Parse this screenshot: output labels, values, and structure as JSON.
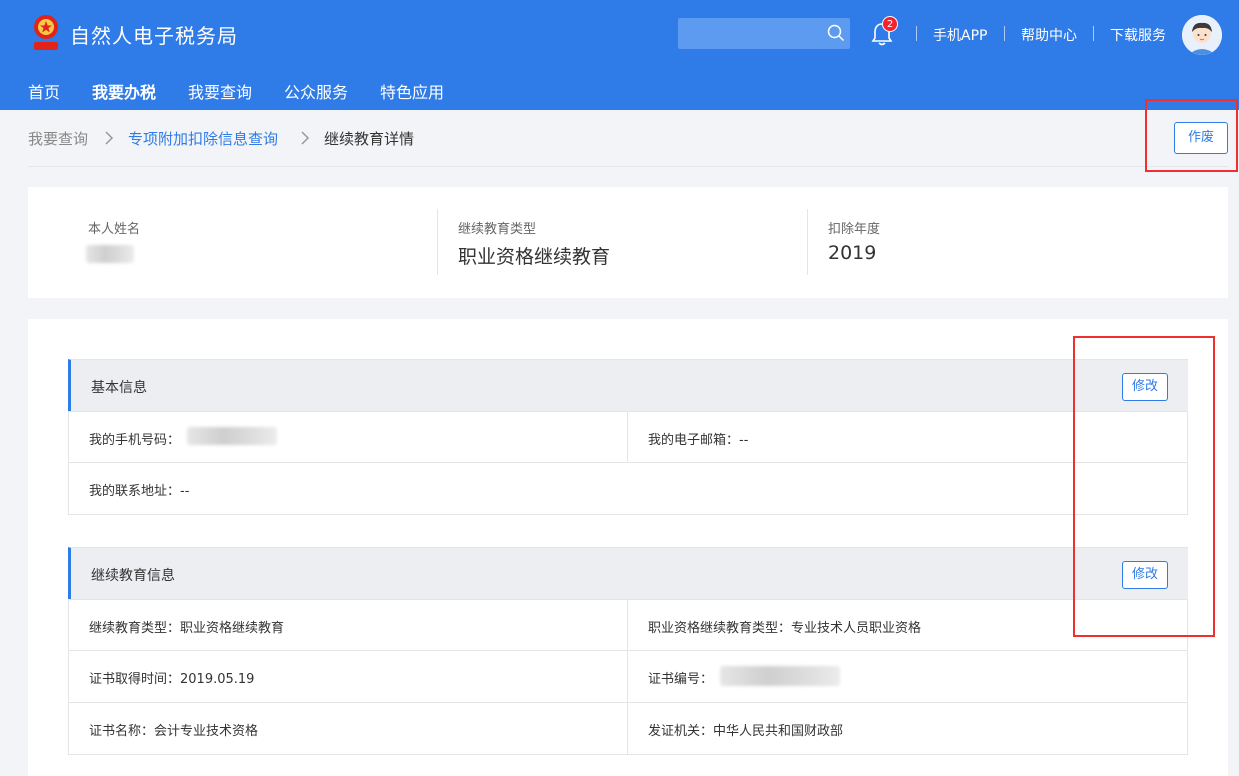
{
  "header": {
    "title": "自然人电子税务局",
    "notification_count": "2",
    "links": [
      "手机APP",
      "帮助中心",
      "下载服务"
    ],
    "brand_color": "#2f7be8"
  },
  "nav": [
    "首页",
    "我要办税",
    "我要查询",
    "公众服务",
    "特色应用"
  ],
  "breadcrumb": {
    "root": "我要查询",
    "parent": "专项附加扣除信息查询",
    "current": "继续教育详情",
    "void_button": "作废"
  },
  "summary": {
    "name_label": "本人姓名",
    "type_label": "继续教育类型",
    "type_value": "职业资格继续教育",
    "year_label": "扣除年度",
    "year_value": "2019"
  },
  "basic": {
    "title": "基本信息",
    "edit": "修改",
    "phone_label": "我的手机号码：",
    "email_label": "我的电子邮箱：",
    "email_value": "--",
    "address_label": "我的联系地址：",
    "address_value": "--"
  },
  "edu": {
    "title": "继续教育信息",
    "edit": "修改",
    "type": "继续教育类型：职业资格继续教育",
    "subtype": "职业资格继续教育类型：专业技术人员职业资格",
    "date": "证书取得时间：2019.05.19",
    "cert_no_label": "证书编号：",
    "cert_name": "证书名称：会计专业技术资格",
    "issuer": "发证机关：中华人民共和国财政部"
  }
}
